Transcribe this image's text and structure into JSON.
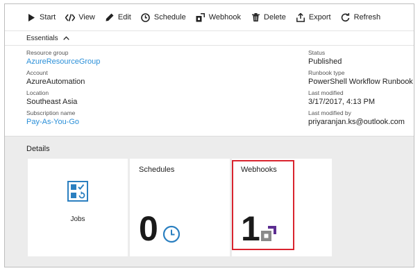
{
  "toolbar": {
    "items": [
      {
        "label": "Start",
        "icon": "play-icon"
      },
      {
        "label": "View",
        "icon": "code-icon"
      },
      {
        "label": "Edit",
        "icon": "pencil-icon"
      },
      {
        "label": "Schedule",
        "icon": "clock-icon"
      },
      {
        "label": "Webhook",
        "icon": "webhook-icon"
      },
      {
        "label": "Delete",
        "icon": "trash-icon"
      },
      {
        "label": "Export",
        "icon": "export-icon"
      },
      {
        "label": "Refresh",
        "icon": "refresh-icon"
      }
    ]
  },
  "essentials": {
    "title": "Essentials",
    "left": [
      {
        "label": "Resource group",
        "value": "AzureResourceGroup",
        "link": true
      },
      {
        "label": "Account",
        "value": "AzureAutomation",
        "link": false
      },
      {
        "label": "Location",
        "value": "Southeast Asia",
        "link": false
      },
      {
        "label": "Subscription name",
        "value": "Pay-As-You-Go",
        "link": true
      }
    ],
    "right": [
      {
        "label": "Status",
        "value": "Published"
      },
      {
        "label": "Runbook type",
        "value": "PowerShell Workflow Runbook"
      },
      {
        "label": "Last modified",
        "value": "3/17/2017, 4:13 PM"
      },
      {
        "label": "Last modified by",
        "value": "priyaranjan.ks@outlook.com"
      }
    ]
  },
  "details": {
    "title": "Details",
    "tiles": {
      "jobs": {
        "label": "Jobs"
      },
      "schedules": {
        "title": "Schedules",
        "count": "0"
      },
      "webhooks": {
        "title": "Webhooks",
        "count": "1"
      }
    }
  },
  "colors": {
    "link": "#2a8fd8",
    "highlight": "#d9232e",
    "details_bg": "#ececec",
    "webhook_purple": "#5c2d91",
    "jobs_blue": "#2a7fc0"
  }
}
